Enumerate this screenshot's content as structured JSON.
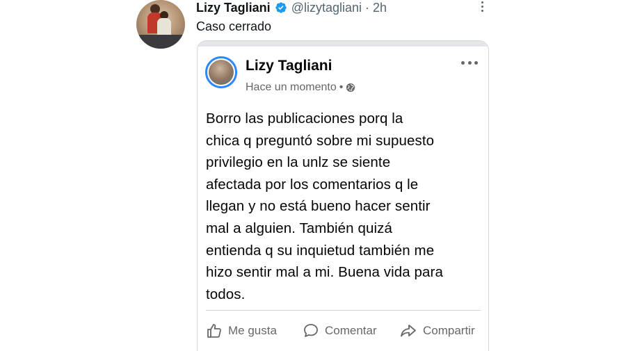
{
  "tweet": {
    "display_name": "Lizy Tagliani",
    "handle": "@lizytagliani",
    "separator": "·",
    "time": "2h",
    "text": "Caso cerrado"
  },
  "fb_post": {
    "author": "Lizy Tagliani",
    "timestamp": "Hace un momento",
    "meta_separator": "•",
    "privacy_icon": "globe-icon",
    "body": "Borro las publicaciones porq la\nchica q preguntó sobre mi supuesto\nprivilegio en la  unlz se siente\nafectada por los comentarios q le\nllegan y no está bueno hacer sentir\nmal a alguien. También quizá\nentienda q su inquietud también me\nhizo sentir mal a mi. Buena vida para\ntodos.",
    "actions": {
      "like": "Me gusta",
      "comment": "Comentar",
      "share": "Compartir"
    }
  },
  "colors": {
    "twitter_verified": "#1d9bf0",
    "fb_ring": "#2d88ff",
    "secondary_text": "#536471",
    "fb_secondary": "#65676b"
  }
}
